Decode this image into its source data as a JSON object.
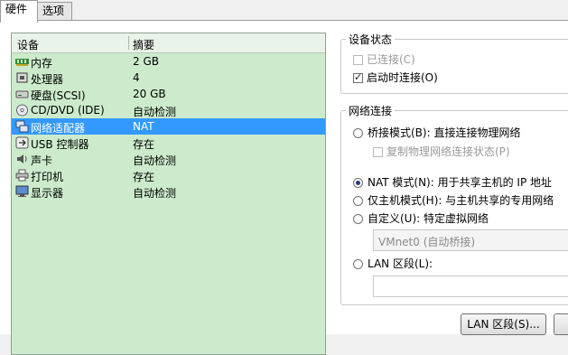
{
  "tabs": [
    {
      "label": "硬件",
      "active": true
    },
    {
      "label": "选项",
      "active": false
    }
  ],
  "device_list": {
    "columns": {
      "device": "设备",
      "summary": "摘要"
    },
    "rows": [
      {
        "name": "内存",
        "summary": "2 GB",
        "icon": "memory-icon"
      },
      {
        "name": "处理器",
        "summary": "4",
        "icon": "cpu-icon"
      },
      {
        "name": "硬盘(SCSI)",
        "summary": "20 GB",
        "icon": "harddisk-icon"
      },
      {
        "name": "CD/DVD (IDE)",
        "summary": "自动检测",
        "icon": "cdrom-icon"
      },
      {
        "name": "网络适配器",
        "summary": "NAT",
        "icon": "network-icon",
        "selected": true
      },
      {
        "name": "USB 控制器",
        "summary": "存在",
        "icon": "usb-icon"
      },
      {
        "name": "声卡",
        "summary": "自动检测",
        "icon": "sound-icon"
      },
      {
        "name": "打印机",
        "summary": "存在",
        "icon": "printer-icon"
      },
      {
        "name": "显示器",
        "summary": "自动检测",
        "icon": "display-icon"
      }
    ]
  },
  "device_status": {
    "title": "设备状态",
    "connected": {
      "label": "已连接(C)",
      "checked": false,
      "enabled": false
    },
    "connect_at_power_on": {
      "label": "启动时连接(O)",
      "checked": true,
      "enabled": true
    }
  },
  "network_connection": {
    "title": "网络连接",
    "bridged": {
      "label": "桥接模式(B): 直接连接物理网络",
      "checked": false
    },
    "replicate_state": {
      "label": "复制物理网络连接状态(P)",
      "checked": false,
      "enabled": false
    },
    "nat": {
      "label": "NAT 模式(N): 用于共享主机的 IP 地址",
      "checked": true
    },
    "host_only": {
      "label": "仅主机模式(H): 与主机共享的专用网络",
      "checked": false
    },
    "custom": {
      "label": "自定义(U): 特定虚拟网络",
      "checked": false
    },
    "custom_network_value": "VMnet0 (自动桥接)",
    "lan_segment": {
      "label": "LAN 区段(L):",
      "checked": false
    },
    "lan_segment_value": ""
  },
  "buttons": {
    "lan_segments": "LAN 区段(S)..."
  },
  "colors": {
    "list_background": "#ccebcc",
    "selection": "#3399ff"
  }
}
